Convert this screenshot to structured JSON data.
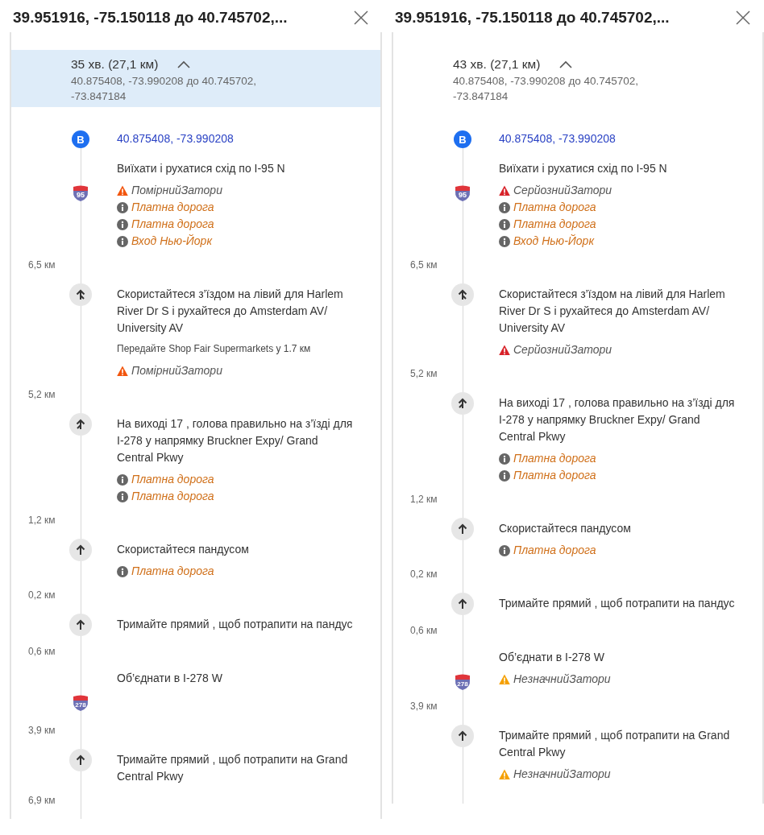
{
  "panels": [
    {
      "title": "39.951916, -75.150118 до 40.745702,...",
      "header": {
        "duration": "35 хв. (27,1 км)",
        "subtitle": "40.875408, -73.990208 до 40.745702, -73.847184",
        "selected": true
      },
      "steps": [
        {
          "kind": "start",
          "marker": "B",
          "text": "40.875408, -73.990208"
        },
        {
          "kind": "shield",
          "shield": "95",
          "text": "Виїхати і рухатися схід по I-95 N",
          "alerts": [
            {
              "kind": "moderate",
              "text": "ПомірнийЗатори"
            },
            {
              "kind": "info",
              "text": "Платна дорога"
            },
            {
              "kind": "info",
              "text": "Платна дорога"
            },
            {
              "kind": "info",
              "text": "Вход Нью-Йорк"
            }
          ],
          "distance": "6,5 км"
        },
        {
          "kind": "fork-left",
          "text": "Скористайтеся з’їздом на лівий для Harlem River Dr S і рухайтеся до Amsterdam AV/ University AV",
          "note": "Передайте Shop Fair Supermarkets у 1.7 км",
          "alerts": [
            {
              "kind": "moderate",
              "text": "ПомірнийЗатори"
            }
          ],
          "distance": "5,2 км"
        },
        {
          "kind": "fork-right",
          "text": "На виході 17 , голова правильно на з’їзді для I-278 у напрямку Bruckner Expy/ Grand Central Pkwy",
          "alerts": [
            {
              "kind": "info",
              "text": "Платна дорога"
            },
            {
              "kind": "info",
              "text": "Платна дорога"
            }
          ],
          "distance": "1,2 км"
        },
        {
          "kind": "straight",
          "text": "Скористайтеся пандусом",
          "alerts": [
            {
              "kind": "info",
              "text": "Платна дорога"
            }
          ],
          "distance": "0,2 км"
        },
        {
          "kind": "straight",
          "text": "Тримайте прямий , щоб потрапити на пандус",
          "distance": "0,6 км"
        },
        {
          "kind": "shield",
          "shield": "278",
          "text": "Об’єднати в I-278 W",
          "distance": "3,9 км"
        },
        {
          "kind": "straight",
          "text": "Тримайте прямий , щоб потрапити на Grand Central Pkwy",
          "distance": "6,9 км"
        }
      ]
    },
    {
      "title": "39.951916, -75.150118 до 40.745702,...",
      "header": {
        "duration": "43 хв. (27,1 км)",
        "subtitle": "40.875408, -73.990208 до 40.745702, -73.847184",
        "selected": false
      },
      "steps": [
        {
          "kind": "start",
          "marker": "B",
          "text": "40.875408, -73.990208"
        },
        {
          "kind": "shield",
          "shield": "95",
          "text": "Виїхати і рухатися схід по I-95 N",
          "alerts": [
            {
              "kind": "serious",
              "text": "СерйознийЗатори"
            },
            {
              "kind": "info",
              "text": "Платна дорога"
            },
            {
              "kind": "info",
              "text": "Платна дорога"
            },
            {
              "kind": "info",
              "text": "Вход Нью-Йорк"
            }
          ],
          "distance": "6,5 км"
        },
        {
          "kind": "fork-left",
          "text": "Скористайтеся з’їздом на лівий для Harlem River Dr S і рухайтеся до Amsterdam AV/ University AV",
          "alerts": [
            {
              "kind": "serious",
              "text": "СерйознийЗатори"
            }
          ],
          "distance": "5,2 км"
        },
        {
          "kind": "fork-right",
          "text": "На виході 17 , голова правильно на з’їзді для I-278 у напрямку Bruckner Expy/ Grand Central Pkwy",
          "alerts": [
            {
              "kind": "info",
              "text": "Платна дорога"
            },
            {
              "kind": "info",
              "text": "Платна дорога"
            }
          ],
          "distance": "1,2 км"
        },
        {
          "kind": "straight",
          "text": "Скористайтеся пандусом",
          "alerts": [
            {
              "kind": "info",
              "text": "Платна дорога"
            }
          ],
          "distance": "0,2 км"
        },
        {
          "kind": "straight",
          "text": "Тримайте прямий , щоб потрапити на пандус",
          "distance": "0,6 км"
        },
        {
          "kind": "shield",
          "shield": "278",
          "text": "Об’єднати в I-278 W",
          "alerts": [
            {
              "kind": "minor",
              "text": "НезначнийЗатори"
            }
          ],
          "distance": "3,9 км"
        },
        {
          "kind": "straight",
          "text": "Тримайте прямий , щоб потрапити на Grand Central Pkwy",
          "alerts": [
            {
              "kind": "minor",
              "text": "НезначнийЗатори"
            }
          ]
        }
      ]
    }
  ]
}
